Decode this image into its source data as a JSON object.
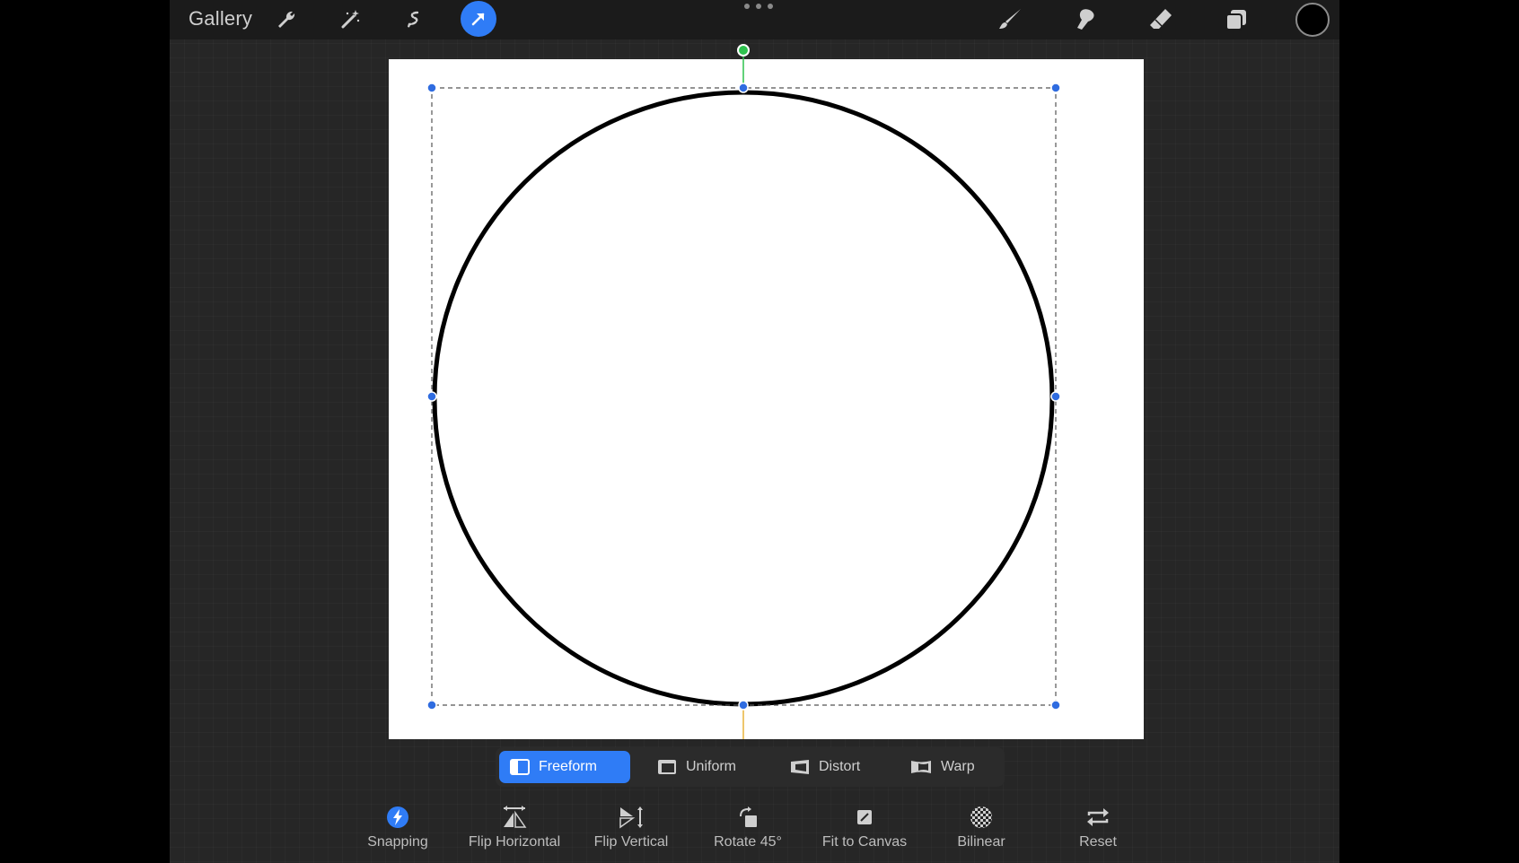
{
  "topbar": {
    "gallery_label": "Gallery",
    "icons": [
      "wrench-icon",
      "magic-wand-icon",
      "selection-icon",
      "transform-arrow-icon",
      "brush-icon",
      "smudge-icon",
      "eraser-icon",
      "layers-icon"
    ],
    "active_tool": "transform",
    "accent_color": "#2f7cf6",
    "current_color": "#000000"
  },
  "transform_modes": [
    {
      "label": "Freeform",
      "active": true
    },
    {
      "label": "Uniform",
      "active": false
    },
    {
      "label": "Distort",
      "active": false
    },
    {
      "label": "Warp",
      "active": false
    }
  ],
  "tools": [
    {
      "label": "Snapping",
      "icon": "snapping-icon",
      "active": true
    },
    {
      "label": "Flip Horizontal",
      "icon": "flip-horizontal-icon"
    },
    {
      "label": "Flip Vertical",
      "icon": "flip-vertical-icon"
    },
    {
      "label": "Rotate 45°",
      "icon": "rotate-icon"
    },
    {
      "label": "Fit to Canvas",
      "icon": "fit-canvas-icon"
    },
    {
      "label": "Bilinear",
      "icon": "bilinear-icon"
    },
    {
      "label": "Reset",
      "icon": "reset-icon"
    }
  ],
  "colors": {
    "handle": "#2f6ce0",
    "rotate_handle": "#2ec24e",
    "pivot_line": "#e8b23a",
    "rotate_line": "#2ec24e"
  }
}
